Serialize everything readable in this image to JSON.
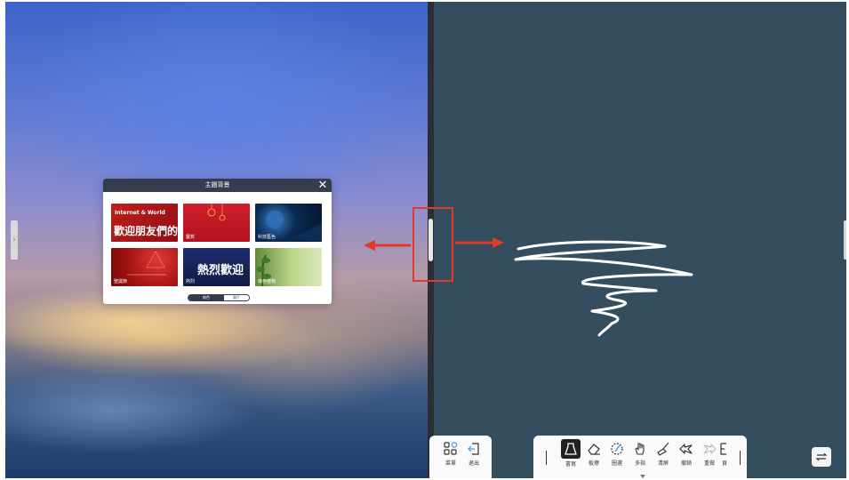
{
  "dialog": {
    "title": "主題背景",
    "close_glyph": "✕",
    "thumbnails": [
      {
        "title": "Internet & World",
        "big": "歡迎朋友們的",
        "caption": ""
      },
      {
        "title": "",
        "big": "",
        "caption": "慶賀"
      },
      {
        "title": "",
        "big": "",
        "caption": "科技藍色"
      },
      {
        "title": "",
        "big": "",
        "caption": "聖誕節"
      },
      {
        "title": "",
        "big": "熱烈歡迎",
        "caption": "熱烈"
      },
      {
        "title": "",
        "big": "",
        "caption": "綠色植物"
      }
    ],
    "pager": {
      "active": "純色",
      "inactive": "圖片"
    }
  },
  "toolbar_left": [
    {
      "label": "菜單",
      "icon": "apps-grid-icon"
    },
    {
      "label": "退出",
      "icon": "exit-icon"
    }
  ],
  "toolbar_main": [
    {
      "label": "書寫",
      "icon": "pen-icon"
    },
    {
      "label": "板擦",
      "icon": "eraser-icon"
    },
    {
      "label": "圈選",
      "icon": "lasso-select-icon"
    },
    {
      "label": "多指",
      "icon": "hand-icon"
    },
    {
      "label": "清屏",
      "icon": "broom-icon"
    },
    {
      "label": "撤銷",
      "icon": "undo-icon"
    },
    {
      "label": "重做",
      "icon": "redo-icon"
    },
    {
      "label": "頁",
      "icon": "page-icon"
    }
  ],
  "colors": {
    "left_pane_top": "#3b63c9",
    "right_pane": "#344d5f",
    "divider": "#2b2f33",
    "highlight": "#e23a2a",
    "dialog_header": "#343d4f",
    "active_tool": "#222222"
  }
}
